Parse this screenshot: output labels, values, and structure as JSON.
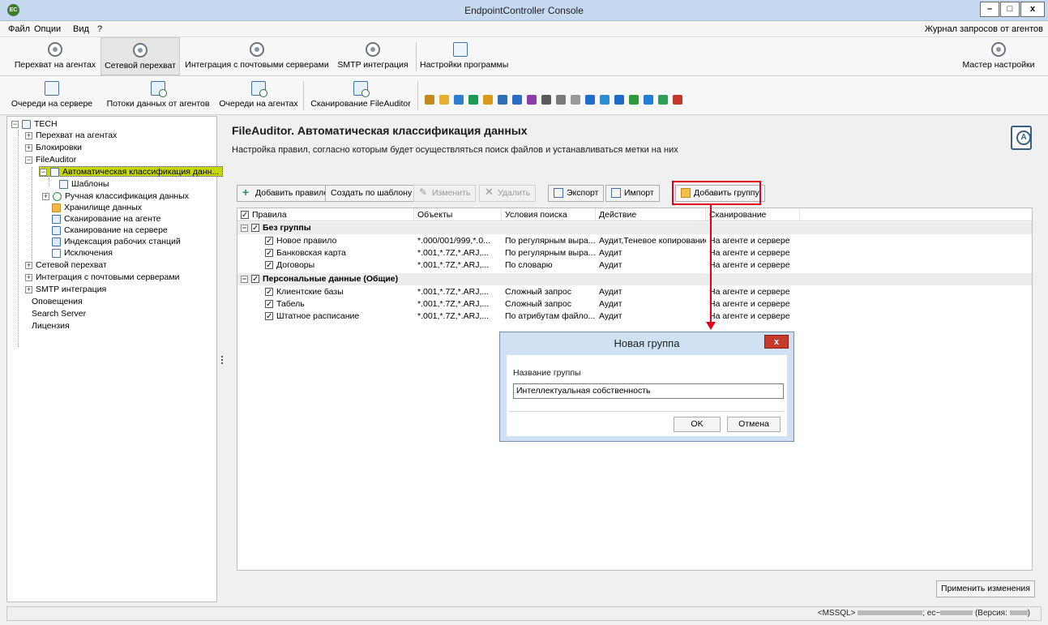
{
  "window": {
    "title": "EndpointController Console",
    "app_icon": "EC",
    "minimize": "–",
    "maximize": "□",
    "close": "x"
  },
  "menu": {
    "file": "Файл",
    "options": "Опции",
    "view": "Вид",
    "help": "?",
    "agent_log": "Журнал запросов от агентов"
  },
  "toolbar1": {
    "agent_intercept": "Перехват на агентах",
    "network_intercept": "Сетевой перехват",
    "mail_integration": "Интеграция с почтовыми серверами",
    "smtp_integration": "SMTP интеграция",
    "program_settings": "Настройки программы",
    "setup_wizard": "Мастер настройки"
  },
  "toolbar2": {
    "server_queues": "Очереди на сервере",
    "agent_data_streams": "Потоки данных от агентов",
    "agent_queues": "Очереди на агентах",
    "fileauditor_scan": "Сканирование FileAuditor",
    "channel_colors": [
      "#c58a1e",
      "#e8b02a",
      "#2e7dd1",
      "#1a9a52",
      "#d89a1a",
      "#2f6fb8",
      "#2b6cc4",
      "#8b3fa8",
      "#5a5a5a",
      "#7a7a7a",
      "#9a9a9a",
      "#1f6fd0",
      "#2a8fd0",
      "#1e6bc7",
      "#2c9a3a",
      "#1f7fd4",
      "#2e9e5a",
      "#c0392b"
    ]
  },
  "tree": {
    "root": "TECH",
    "items": [
      "Перехват на агентах",
      "Блокировки",
      "FileAuditor",
      "Автоматическая классификация данн...",
      "Шаблоны",
      "Ручная классификация данных",
      "Хранилище данных",
      "Сканирование на агенте",
      "Сканирование на сервере",
      "Индексация рабочих станций",
      "Исключения",
      "Сетевой перехват",
      "Интеграция с почтовыми серверами",
      "SMTP интеграция",
      "Оповещения",
      "Search Server",
      "Лицензия"
    ]
  },
  "main": {
    "title": "FileAuditor. Автоматическая классификация данных",
    "description": "Настройка правил, согласно которым будет осуществляться поиск файлов и устанавливаться метки на них"
  },
  "actions": {
    "add_rule": "Добавить правило",
    "create_from_template": "Создать по шаблону",
    "edit": "Изменить",
    "delete": "Удалить",
    "export": "Экспорт",
    "import": "Импорт",
    "add_group": "Добавить группу"
  },
  "grid": {
    "columns": [
      "Правила",
      "Объекты",
      "Условия поиска",
      "Действие",
      "Сканирование"
    ],
    "groups": [
      {
        "name": "Без группы",
        "rows": [
          [
            "Новое правило",
            "*.000/001/999,*.0...",
            "По регулярным выра...",
            "Аудит,Теневое копирование",
            "На агенте и сервере"
          ],
          [
            "Банковская карта",
            "*.001,*.7Z,*.ARJ,...",
            "По регулярным выра...",
            "Аудит",
            "На агенте и сервере"
          ],
          [
            "Договоры",
            "*.001,*.7Z,*.ARJ,...",
            "По словарю",
            "Аудит",
            "На агенте и сервере"
          ]
        ]
      },
      {
        "name": "Персональные данные (Общие)",
        "rows": [
          [
            "Клиентские базы",
            "*.001,*.7Z,*.ARJ,...",
            "Сложный запрос",
            "Аудит",
            "На агенте и сервере"
          ],
          [
            "Табель",
            "*.001,*.7Z,*.ARJ,...",
            "Сложный запрос",
            "Аудит",
            "На агенте и сервере"
          ],
          [
            "Штатное расписание",
            "*.001,*.7Z,*.ARJ,...",
            "По атрибутам файло...",
            "Аудит",
            "На агенте и сервере"
          ]
        ]
      }
    ]
  },
  "apply_button": "Применить изменения",
  "dialog": {
    "title": "Новая группа",
    "close": "x",
    "field_label": "Название группы",
    "field_value": "Интеллектуальная собственность",
    "ok": "OK",
    "cancel": "Отмена"
  },
  "status": {
    "db": "<MSSQL>",
    "sep": ";",
    "host_prefix": "ec~",
    "version_prefix": "(Версия:",
    "version_suffix": ")"
  },
  "colors": {
    "accent_highlight": "#e0001b",
    "selection": "#c6d800",
    "titlebar": "#c6d9f0"
  }
}
